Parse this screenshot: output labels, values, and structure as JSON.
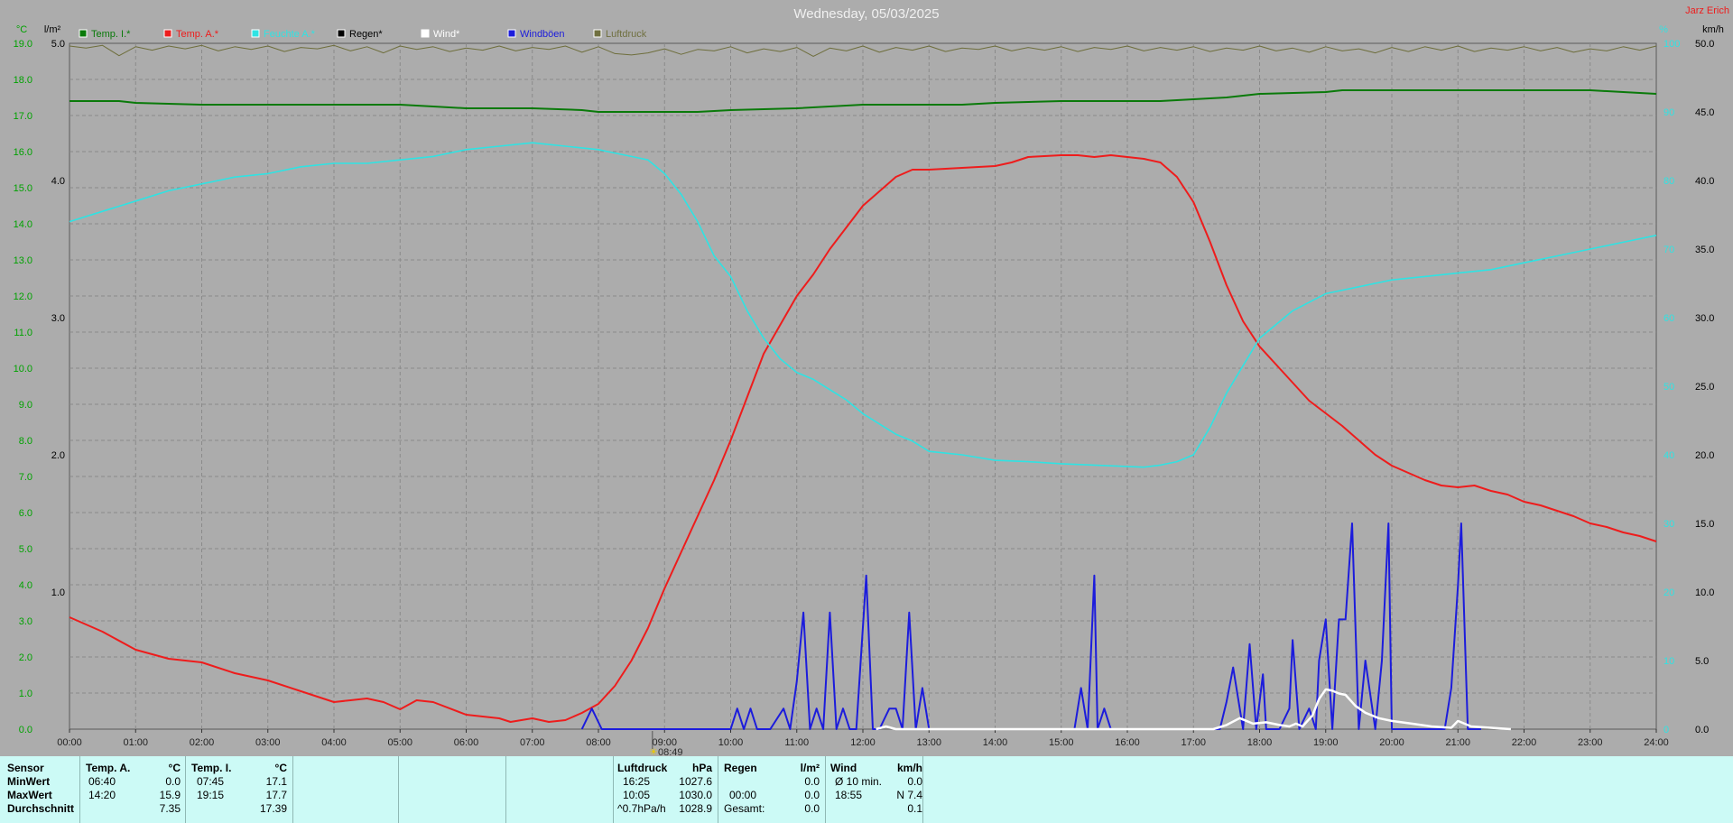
{
  "header": {
    "title": "Wednesday, 05/03/2025",
    "corner_label": "Jarz Erich",
    "left_unit_temp": "°C",
    "left_unit_rain": "l/m²",
    "right_unit_wind": "km/h",
    "right_unit_pct": "%",
    "marker_label": "08:49"
  },
  "legend": [
    {
      "label": "Temp. I.*",
      "color": "#0a7a0a"
    },
    {
      "label": "Temp. A.*",
      "color": "#ee1c1c"
    },
    {
      "label": "Feuchte A.*",
      "color": "#2fe3e3"
    },
    {
      "label": "Regen*",
      "color": "#000000"
    },
    {
      "label": "Wind*",
      "color": "#ffffff"
    },
    {
      "label": "Windböen",
      "color": "#1c1cdc"
    },
    {
      "label": "Luftdruck",
      "color": "#707040"
    }
  ],
  "colors": {
    "temp_in": "#0a7a0a",
    "temp_out": "#ee1c1c",
    "humidity": "#2fe3e3",
    "gusts": "#1c1cdc",
    "wind": "#ffffff",
    "pressure": "#6e6e3c",
    "axis_temp": "#00a200",
    "axis_rain": "#000000",
    "axis_right": "#2fe3e3",
    "title": "#f0f0f0",
    "corner": "#ee1c1c",
    "grid": "#8a8a8a",
    "background": "#acacac",
    "stats_bg": "#ccfaf6"
  },
  "chart_data": {
    "type": "line",
    "x_unit": "hours",
    "xlim": [
      0,
      24
    ],
    "x_ticks": [
      "00:00",
      "01:00",
      "02:00",
      "03:00",
      "04:00",
      "05:00",
      "06:00",
      "07:00",
      "08:00",
      "09:00",
      "10:00",
      "11:00",
      "12:00",
      "13:00",
      "14:00",
      "15:00",
      "16:00",
      "17:00",
      "18:00",
      "19:00",
      "20:00",
      "21:00",
      "22:00",
      "23:00",
      "24:00"
    ],
    "temp_axis": {
      "range": [
        0,
        19
      ],
      "ticks": [
        "0.0",
        "1.0",
        "2.0",
        "3.0",
        "4.0",
        "5.0",
        "6.0",
        "7.0",
        "8.0",
        "9.0",
        "10.0",
        "11.0",
        "12.0",
        "13.0",
        "14.0",
        "15.0",
        "16.0",
        "17.0",
        "18.0",
        "19.0"
      ]
    },
    "rain_axis": {
      "range": [
        0,
        5
      ],
      "ticks": [
        "1.0",
        "2.0",
        "3.0",
        "4.0",
        "5.0"
      ]
    },
    "wind_axis": {
      "range": [
        0,
        50
      ],
      "ticks": [
        "0.0",
        "5.0",
        "10.0",
        "15.0",
        "20.0",
        "25.0",
        "30.0",
        "35.0",
        "40.0",
        "45.0",
        "50.0"
      ]
    },
    "pct_axis": {
      "range": [
        0,
        100
      ],
      "ticks": [
        "0",
        "10",
        "20",
        "30",
        "40",
        "50",
        "60",
        "70",
        "80",
        "90",
        "100"
      ]
    },
    "grid": true,
    "series": [
      {
        "name": "Temp. I.*",
        "axis": "temp",
        "color": "#0a7a0a",
        "x": [
          0,
          0.75,
          1,
          2,
          3,
          4,
          5,
          5.5,
          6,
          7,
          7.75,
          8,
          9,
          9.5,
          10,
          11,
          12,
          13,
          13.5,
          14,
          15,
          16,
          16.5,
          17,
          17.5,
          18,
          19,
          19.25,
          20,
          21,
          22,
          23,
          23.5,
          24
        ],
        "y": [
          17.4,
          17.4,
          17.35,
          17.3,
          17.3,
          17.3,
          17.3,
          17.25,
          17.2,
          17.2,
          17.15,
          17.1,
          17.1,
          17.1,
          17.15,
          17.2,
          17.3,
          17.3,
          17.3,
          17.35,
          17.4,
          17.4,
          17.4,
          17.45,
          17.5,
          17.6,
          17.65,
          17.7,
          17.7,
          17.7,
          17.7,
          17.7,
          17.65,
          17.6
        ]
      },
      {
        "name": "Temp. A.*",
        "axis": "temp",
        "color": "#ee1c1c",
        "x": [
          0,
          0.5,
          1,
          1.5,
          2,
          2.5,
          3,
          3.5,
          4,
          4.25,
          4.5,
          4.75,
          5,
          5.25,
          5.5,
          6,
          6.25,
          6.5,
          6.67,
          7,
          7.25,
          7.5,
          7.75,
          8,
          8.25,
          8.5,
          8.75,
          9,
          9.25,
          9.5,
          9.75,
          10,
          10.25,
          10.5,
          10.75,
          11,
          11.25,
          11.5,
          11.75,
          12,
          12.25,
          12.5,
          12.75,
          13,
          13.5,
          14,
          14.25,
          14.5,
          15,
          15.25,
          15.5,
          15.75,
          16,
          16.25,
          16.5,
          16.75,
          17,
          17.25,
          17.5,
          17.75,
          18,
          18.25,
          18.5,
          18.75,
          19,
          19.25,
          19.5,
          19.75,
          20,
          20.25,
          20.5,
          20.75,
          21,
          21.25,
          21.5,
          21.75,
          22,
          22.25,
          22.5,
          22.75,
          23,
          23.25,
          23.5,
          23.75,
          24
        ],
        "y": [
          3.1,
          2.7,
          2.2,
          1.95,
          1.85,
          1.55,
          1.35,
          1.05,
          0.75,
          0.8,
          0.85,
          0.75,
          0.55,
          0.8,
          0.75,
          0.4,
          0.35,
          0.3,
          0.2,
          0.3,
          0.2,
          0.25,
          0.45,
          0.7,
          1.2,
          1.9,
          2.8,
          3.9,
          4.9,
          5.9,
          6.9,
          8.0,
          9.2,
          10.4,
          11.2,
          12.0,
          12.6,
          13.3,
          13.9,
          14.5,
          14.9,
          15.3,
          15.5,
          15.5,
          15.55,
          15.6,
          15.7,
          15.85,
          15.9,
          15.9,
          15.85,
          15.9,
          15.85,
          15.8,
          15.7,
          15.3,
          14.6,
          13.5,
          12.3,
          11.3,
          10.6,
          10.1,
          9.6,
          9.1,
          8.75,
          8.4,
          8.0,
          7.6,
          7.3,
          7.1,
          6.9,
          6.75,
          6.7,
          6.75,
          6.6,
          6.5,
          6.3,
          6.2,
          6.05,
          5.9,
          5.7,
          5.6,
          5.45,
          5.35,
          5.2
        ]
      },
      {
        "name": "Feuchte A.*",
        "axis": "pct",
        "color": "#2fe3e3",
        "x": [
          0,
          0.5,
          1,
          1.5,
          2,
          2.5,
          3,
          3.5,
          4,
          4.5,
          5,
          5.5,
          6,
          6.5,
          7,
          7.5,
          8,
          8.25,
          8.5,
          8.75,
          9,
          9.25,
          9.5,
          9.75,
          10,
          10.25,
          10.5,
          10.75,
          11,
          11.25,
          11.5,
          11.75,
          12,
          12.25,
          12.5,
          12.75,
          13,
          13.5,
          14,
          14.5,
          15,
          15.5,
          16,
          16.25,
          16.5,
          16.75,
          17,
          17.25,
          17.5,
          17.75,
          18,
          18.5,
          19,
          19.5,
          20,
          20.5,
          21,
          21.5,
          22,
          22.5,
          23,
          23.5,
          24
        ],
        "y": [
          74,
          75.5,
          77,
          78.5,
          79.5,
          80.5,
          81,
          82,
          82.5,
          82.5,
          83,
          83.5,
          84.5,
          85,
          85.5,
          85,
          84.5,
          84,
          83.5,
          83,
          81,
          78,
          74,
          69,
          66,
          61,
          57,
          54,
          52,
          51,
          49.5,
          48,
          46,
          44.5,
          43,
          42,
          40.5,
          40,
          39.2,
          39,
          38.7,
          38.5,
          38.3,
          38.2,
          38.5,
          39,
          40,
          44,
          49,
          53,
          57,
          61,
          63.5,
          64.5,
          65.5,
          66,
          66.5,
          67,
          68,
          69,
          70,
          71,
          72
        ]
      },
      {
        "name": "Windböen",
        "axis": "wind",
        "color": "#1c1cdc",
        "x": [
          7.75,
          7.9,
          8.05,
          10.0,
          10.1,
          10.2,
          10.3,
          10.4,
          10.6,
          10.8,
          10.9,
          11.0,
          11.1,
          11.2,
          11.3,
          11.4,
          11.5,
          11.6,
          11.7,
          11.8,
          11.9,
          12.05,
          12.15,
          12.25,
          12.4,
          12.5,
          12.6,
          12.7,
          12.8,
          12.9,
          13.0,
          13.05,
          13.15,
          15.2,
          15.3,
          15.4,
          15.5,
          15.55,
          15.65,
          15.75,
          15.8,
          15.9,
          16.0,
          17.4,
          17.5,
          17.6,
          17.75,
          17.85,
          17.95,
          18.05,
          18.1,
          18.3,
          18.45,
          18.5,
          18.6,
          18.75,
          18.85,
          18.9,
          19.0,
          19.1,
          19.2,
          19.3,
          19.4,
          19.5,
          19.6,
          19.75,
          19.85,
          19.95,
          20.0,
          20.1,
          20.8,
          20.9,
          21.0,
          21.05,
          21.15,
          21.2,
          21.3,
          21.35
        ],
        "y": [
          0,
          1.5,
          0,
          0,
          1.5,
          0,
          1.5,
          0,
          0,
          1.5,
          0,
          3.5,
          8.5,
          0,
          1.5,
          0,
          8.5,
          0,
          1.5,
          0,
          0,
          11.2,
          0,
          0,
          1.5,
          1.5,
          0,
          8.5,
          0,
          3.0,
          0,
          0,
          0,
          0,
          3.0,
          0,
          11.2,
          0,
          1.5,
          0,
          0,
          0,
          0,
          0,
          2.0,
          4.5,
          0,
          6.2,
          0,
          4.0,
          0,
          0,
          1.5,
          6.5,
          0,
          1.5,
          0,
          5.0,
          8.0,
          0,
          8.0,
          8.0,
          15.0,
          0,
          5.0,
          0,
          5.0,
          15.0,
          0,
          0,
          0,
          3.0,
          10.5,
          15.0,
          0,
          0,
          0,
          0
        ]
      },
      {
        "name": "Wind*",
        "axis": "wind",
        "color": "#ffffff",
        "x": [
          12.2,
          12.35,
          12.5,
          17.3,
          17.5,
          17.7,
          17.9,
          18.1,
          18.3,
          18.45,
          18.55,
          18.65,
          18.8,
          18.9,
          19.0,
          19.1,
          19.2,
          19.3,
          19.45,
          19.6,
          19.8,
          20.0,
          20.3,
          20.6,
          20.9,
          21.0,
          21.2,
          21.5,
          21.8
        ],
        "y": [
          0,
          0.2,
          0,
          0,
          0.3,
          0.8,
          0.4,
          0.5,
          0.3,
          0.2,
          0.4,
          0.2,
          1.0,
          2.2,
          2.9,
          2.8,
          2.6,
          2.5,
          1.7,
          1.2,
          0.8,
          0.6,
          0.4,
          0.2,
          0.1,
          0.6,
          0.2,
          0.1,
          0
        ]
      },
      {
        "name": "Luftdruck",
        "axis": "pct",
        "color": "#6e6e3c",
        "x": [
          0,
          0.25,
          0.5,
          0.75,
          1,
          1.25,
          1.5,
          1.75,
          2,
          2.25,
          2.5,
          2.75,
          3,
          3.25,
          3.5,
          3.75,
          4,
          4.25,
          4.5,
          4.75,
          5,
          5.25,
          5.5,
          5.75,
          6,
          6.25,
          6.5,
          6.75,
          7,
          7.25,
          7.5,
          7.75,
          8,
          8.25,
          8.5,
          8.75,
          9,
          9.25,
          9.5,
          9.75,
          10,
          10.25,
          10.5,
          10.75,
          11,
          11.25,
          11.5,
          11.75,
          12,
          12.25,
          12.5,
          12.75,
          13,
          13.25,
          13.5,
          13.75,
          14,
          14.25,
          14.5,
          14.75,
          15,
          15.25,
          15.5,
          15.75,
          16,
          16.25,
          16.5,
          16.75,
          17,
          17.25,
          17.5,
          17.75,
          18,
          18.25,
          18.5,
          18.75,
          19,
          19.25,
          19.5,
          19.75,
          20,
          20.25,
          20.5,
          20.75,
          21,
          21.25,
          21.5,
          21.75,
          22,
          22.25,
          22.5,
          22.75,
          23,
          23.25,
          23.5,
          23.75,
          24
        ],
        "y": [
          99.6,
          99.3,
          99.7,
          98.2,
          99.5,
          99.0,
          99.6,
          99.2,
          99.7,
          98.9,
          99.5,
          99.1,
          99.6,
          98.8,
          99.4,
          99.2,
          99.7,
          98.9,
          99.5,
          98.6,
          99.6,
          99.1,
          99.5,
          98.8,
          99.3,
          99.0,
          99.6,
          98.9,
          99.4,
          99.1,
          99.6,
          98.7,
          99.5,
          98.5,
          98.3,
          98.6,
          99.2,
          98.4,
          99.1,
          98.9,
          99.5,
          98.6,
          99.2,
          98.8,
          99.4,
          98.1,
          99.3,
          98.9,
          99.6,
          98.7,
          99.4,
          99.0,
          99.6,
          98.8,
          99.3,
          99.1,
          99.6,
          98.9,
          99.4,
          99.0,
          99.5,
          98.8,
          99.4,
          99.1,
          99.6,
          98.9,
          99.4,
          99.0,
          99.5,
          98.8,
          99.3,
          99.0,
          99.6,
          98.9,
          99.3,
          98.7,
          99.5,
          98.9,
          99.2,
          98.6,
          99.4,
          98.8,
          99.5,
          99.0,
          99.6,
          98.8,
          99.3,
          99.0,
          99.5,
          98.9,
          99.4,
          98.7,
          99.2,
          98.9,
          99.5,
          99.0,
          99.6
        ]
      }
    ]
  },
  "stats": {
    "sensor": {
      "header": "Sensor",
      "rows": [
        "MinWert",
        "MaxWert",
        "Durchschnitt"
      ]
    },
    "temp_a": {
      "header": "Temp. A.",
      "unit": "°C",
      "min_time": "06:40",
      "min_val": "0.0",
      "max_time": "14:20",
      "max_val": "15.9",
      "avg": "7.35"
    },
    "temp_i": {
      "header": "Temp. I.",
      "unit": "°C",
      "min_time": "07:45",
      "min_val": "17.1",
      "max_time": "19:15",
      "max_val": "17.7",
      "avg": "17.39"
    },
    "pressure": {
      "header": "Luftdruck",
      "unit": "hPa",
      "min_time": "16:25",
      "min_val": "1027.6",
      "max_time": "10:05",
      "max_val": "1030.0",
      "trend": "^0.7hPa/h",
      "avg": "1028.9"
    },
    "rain": {
      "header": "Regen",
      "unit": "l/m²",
      "row1_val": "0.0",
      "row2_time": "00:00",
      "row2_val": "0.0",
      "total_label": "Gesamt:",
      "total_val": "0.0"
    },
    "wind": {
      "header": "Wind",
      "unit": "km/h",
      "row1_label": "Ø 10 min.",
      "row1_val": "0.0",
      "max_time": "18:55",
      "max_val": "N 7.4",
      "avg": "0.1"
    }
  }
}
